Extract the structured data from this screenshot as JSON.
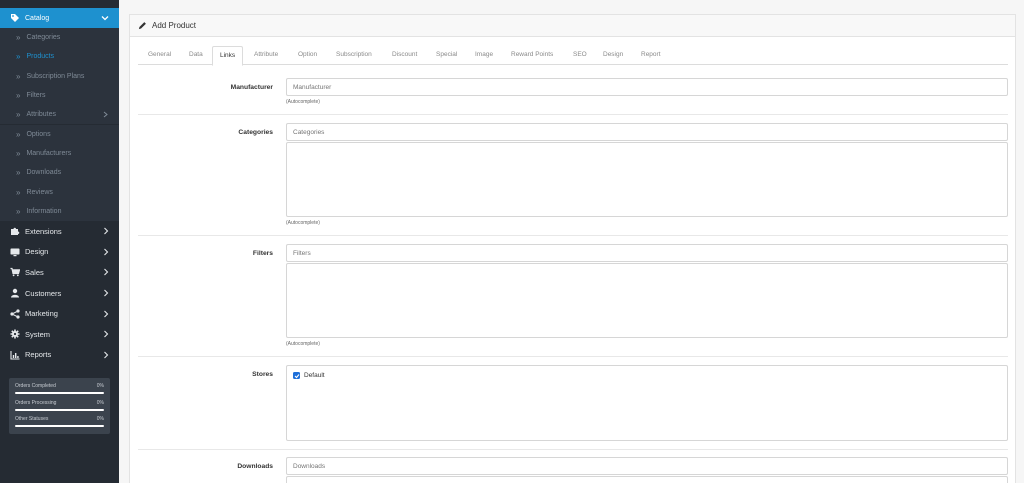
{
  "sidebar": {
    "catalog_label": "Catalog",
    "catalog_items": [
      {
        "label": "Categories"
      },
      {
        "label": "Products"
      },
      {
        "label": "Subscription Plans"
      },
      {
        "label": "Filters"
      },
      {
        "label": "Attributes"
      },
      {
        "label": "Options"
      },
      {
        "label": "Manufacturers"
      },
      {
        "label": "Downloads"
      },
      {
        "label": "Reviews"
      },
      {
        "label": "Information"
      }
    ],
    "nav": [
      {
        "label": "Extensions",
        "icon": "puzzle-icon"
      },
      {
        "label": "Design",
        "icon": "monitor-icon"
      },
      {
        "label": "Sales",
        "icon": "cart-icon"
      },
      {
        "label": "Customers",
        "icon": "user-icon"
      },
      {
        "label": "Marketing",
        "icon": "share-icon"
      },
      {
        "label": "System",
        "icon": "gear-icon"
      },
      {
        "label": "Reports",
        "icon": "chart-icon"
      }
    ],
    "stats": [
      {
        "label": "Orders Completed",
        "percent": "0%",
        "value": 0
      },
      {
        "label": "Orders Processing",
        "percent": "0%",
        "value": 0
      },
      {
        "label": "Other Statuses",
        "percent": "0%",
        "value": 0
      }
    ]
  },
  "panel": {
    "title": "Add Product",
    "tabs": [
      "General",
      "Data",
      "Links",
      "Attribute",
      "Option",
      "Subscription",
      "Discount",
      "Special",
      "Image",
      "Reward Points",
      "SEO",
      "Design",
      "Report"
    ],
    "active_tab": "Links"
  },
  "form": {
    "manufacturer": {
      "label": "Manufacturer",
      "placeholder": "Manufacturer",
      "help": "(Autocomplete)"
    },
    "categories": {
      "label": "Categories",
      "placeholder": "Categories",
      "help": "(Autocomplete)"
    },
    "filters": {
      "label": "Filters",
      "placeholder": "Filters",
      "help": "(Autocomplete)"
    },
    "stores": {
      "label": "Stores",
      "option": "Default",
      "checked": true
    },
    "downloads": {
      "label": "Downloads",
      "placeholder": "Downloads"
    }
  },
  "colors": {
    "accent": "#1e91cf",
    "sidebar_bg": "#252b33",
    "submenu_bg": "#2c333d"
  }
}
